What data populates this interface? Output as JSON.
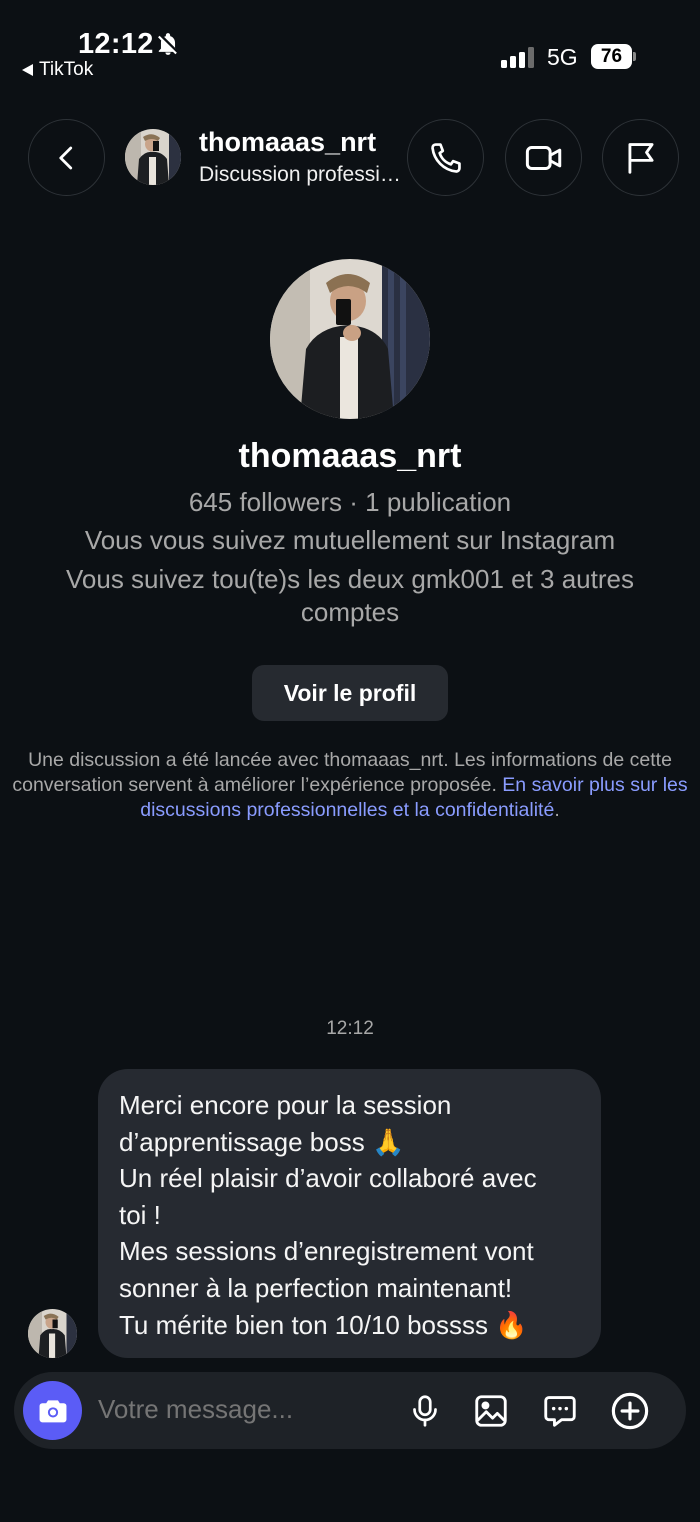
{
  "status_bar": {
    "time": "12:12",
    "back_app": "TikTok",
    "network": "5G",
    "battery": "76"
  },
  "header": {
    "username": "thomaaas_nrt",
    "subtitle": "Discussion professionnelle"
  },
  "profile": {
    "username": "thomaaas_nrt",
    "stats": "645 followers · 1 publication",
    "mutual": "Vous vous suivez mutuellement sur Instagram",
    "common_line1": "Vous suivez tou(te)s les deux gmk001 et 3 autres",
    "common_line2": "comptes",
    "view_profile_button": "Voir le profil"
  },
  "disclaimer": {
    "text": "Une discussion a été lancée avec thomaaas_nrt. Les informations de cette conversation servent à améliorer l’expérience proposée.",
    "link": "En savoir plus sur les discussions professionnelles et la confidentialité",
    "end": "."
  },
  "conversation": {
    "timestamp": "12:12",
    "message_lines": [
      "Merci encore pour la session",
      "d’apprentissage boss 🙏",
      "Un réel plaisir d’avoir collaboré avec",
      "toi !",
      "Mes sessions d’enregistrement vont",
      "sonner à la perfection maintenant!",
      "Tu mérite bien ton 10/10 bossss 🔥"
    ]
  },
  "composer": {
    "placeholder": "Votre message..."
  },
  "colors": {
    "background": "#0c1014",
    "bubble": "#262a31",
    "accent": "#5b5cf6",
    "link": "#8a9cff",
    "muted_text": "#a8a8a8"
  },
  "icons": {
    "header": [
      "back-icon",
      "phone-icon",
      "video-icon",
      "flag-icon"
    ],
    "composer": [
      "camera-icon",
      "microphone-icon",
      "gallery-icon",
      "sticker-icon",
      "plus-icon"
    ],
    "status": [
      "bell-off-icon",
      "signal-icon",
      "battery-icon"
    ]
  }
}
